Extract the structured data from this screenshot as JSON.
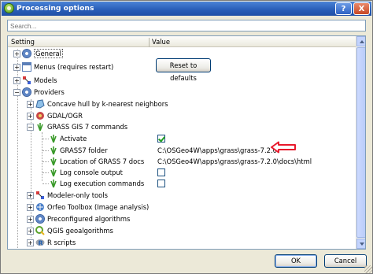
{
  "window": {
    "title": "Processing options",
    "help_label": "?",
    "close_label": "X"
  },
  "search": {
    "placeholder": "Search..."
  },
  "columns": {
    "setting": "Setting",
    "value": "Value"
  },
  "tree": {
    "general": "General",
    "menus": "Menus (requires restart)",
    "reset_button": "Reset to defaults",
    "models": "Models",
    "providers": "Providers",
    "concave_hull": "Concave hull by k-nearest neighbors",
    "gdal": "GDAL/OGR",
    "grass7": "GRASS GIS 7 commands",
    "activate": "Activate",
    "grass7_folder": "GRASS7 folder",
    "grass7_folder_value": "C:\\OSGeo4W\\apps\\grass\\grass-7.2.0",
    "grass7_docs": "Location of GRASS 7 docs",
    "grass7_docs_value": "C:\\OSGeo4W\\apps\\grass\\grass-7.2.0\\docs\\html",
    "log_console": "Log console output",
    "log_commands": "Log execution commands",
    "modeler_only": "Modeler-only tools",
    "orfeo": "Orfeo Toolbox (Image analysis)",
    "preconfigured": "Preconfigured algorithms",
    "qgis_geo": "QGIS geoalgorithms",
    "r_scripts": "R scripts"
  },
  "checkbox_states": {
    "activate": true,
    "log_console": false,
    "log_commands": false
  },
  "buttons": {
    "ok": "OK",
    "cancel": "Cancel"
  },
  "colors": {
    "annotation_arrow": "#e8192c",
    "titlebar": "#2a5fb9"
  }
}
